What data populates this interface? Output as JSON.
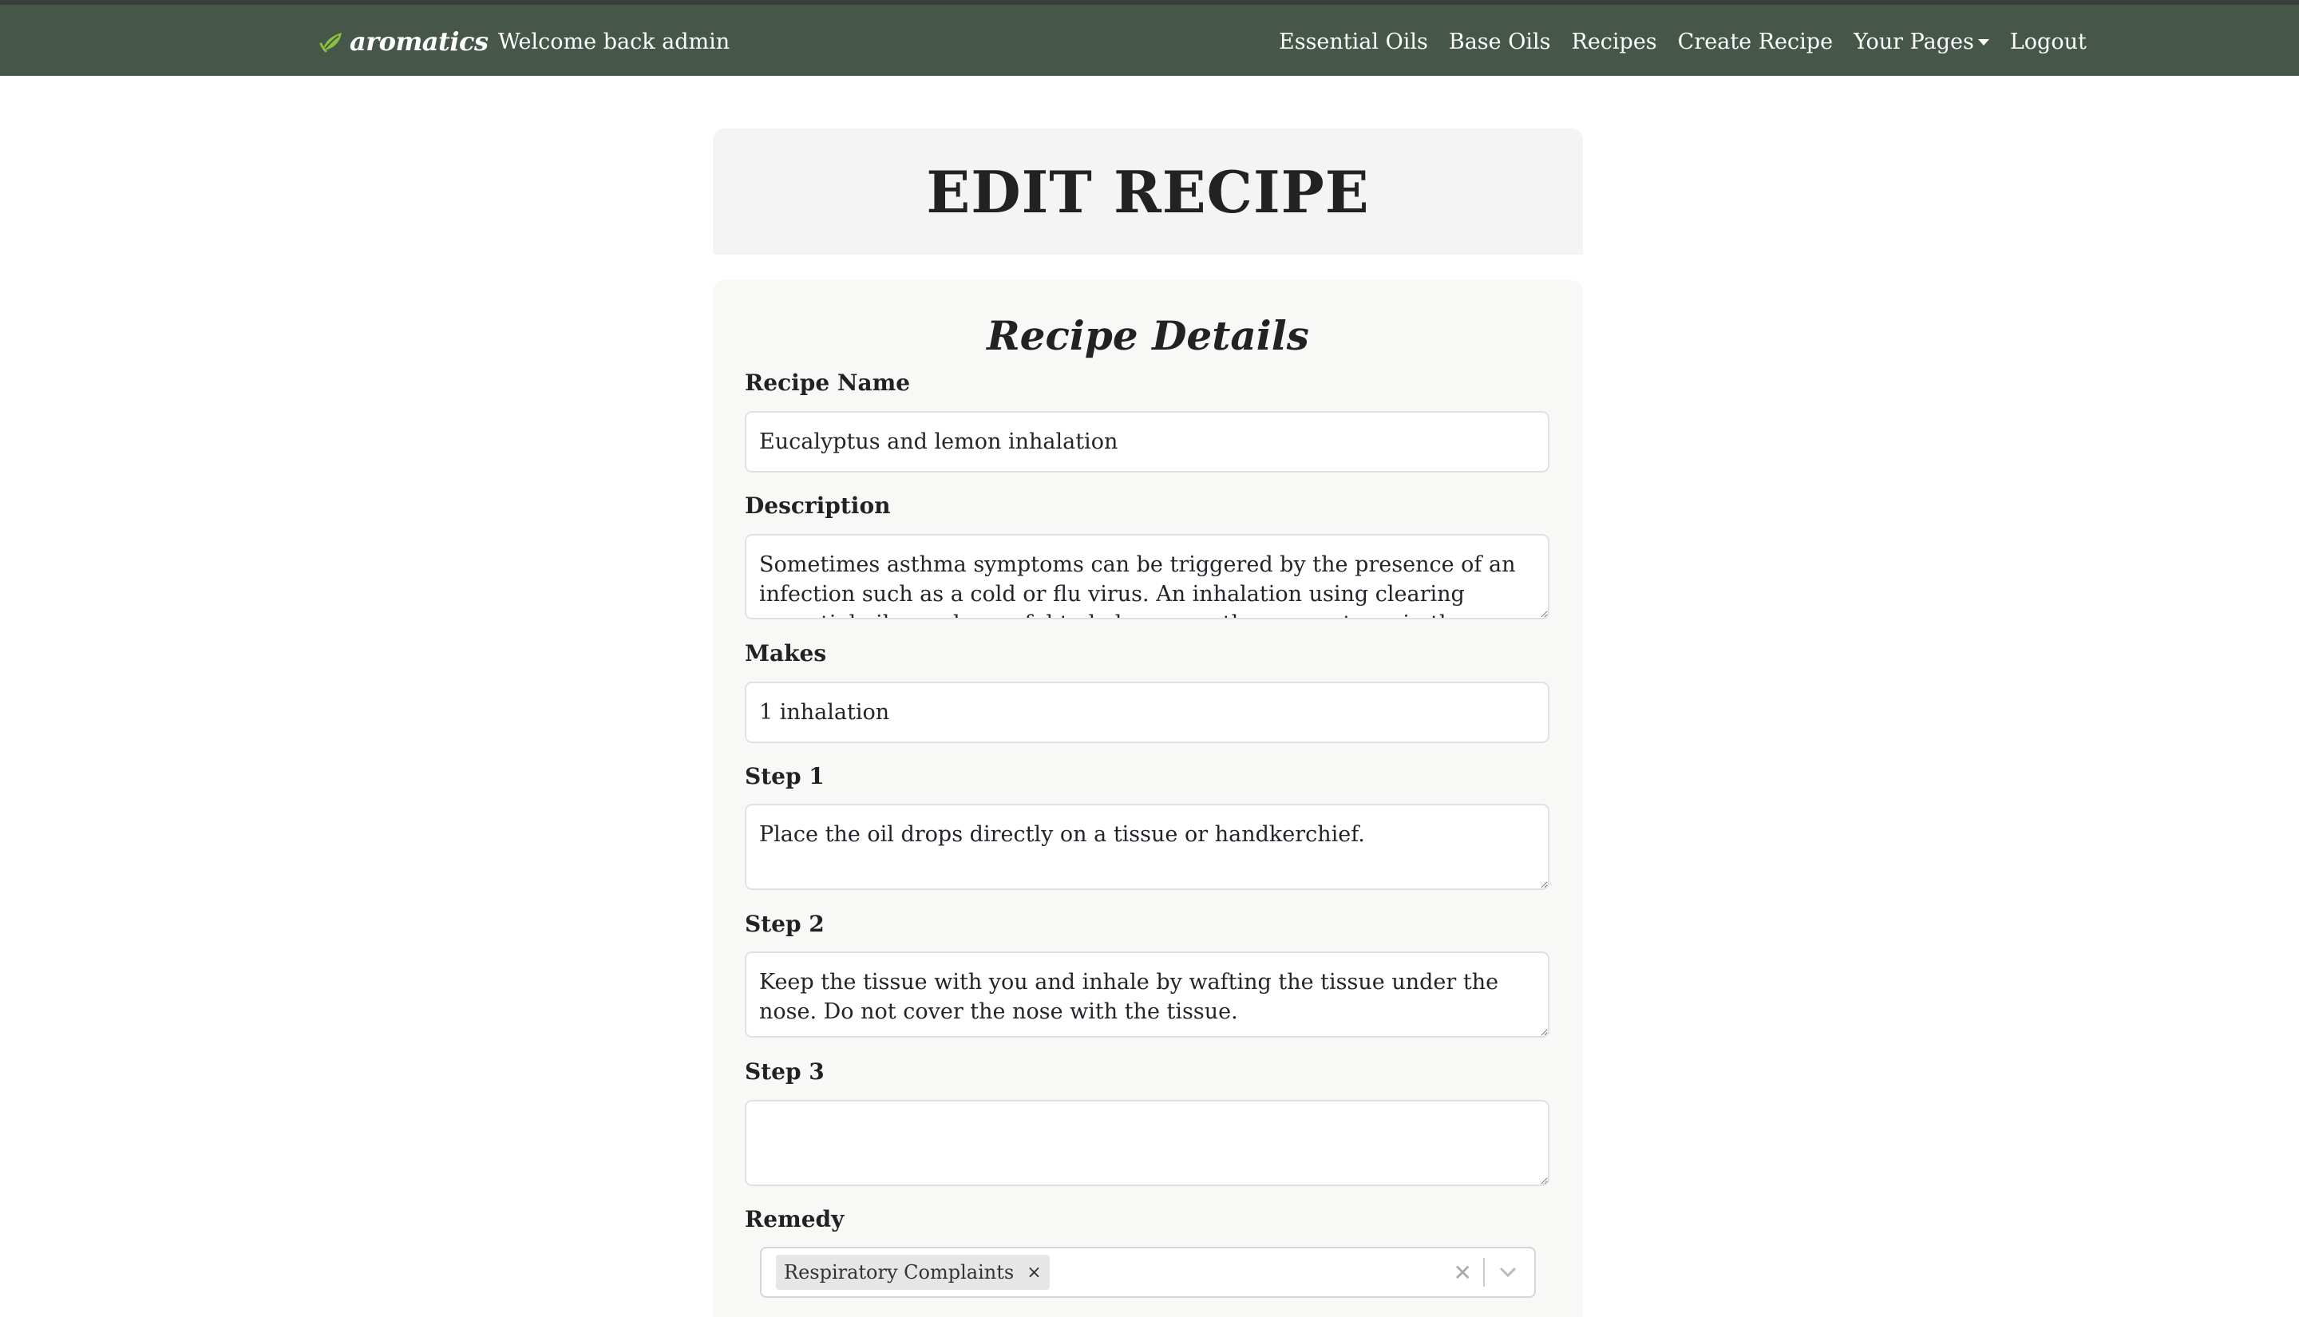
{
  "navbar": {
    "brand": "aromatics",
    "welcome": "Welcome back admin",
    "links": [
      {
        "label": "Essential Oils"
      },
      {
        "label": "Base Oils"
      },
      {
        "label": "Recipes"
      },
      {
        "label": "Create Recipe"
      },
      {
        "label": "Your Pages",
        "dropdown": true
      },
      {
        "label": "Logout"
      }
    ],
    "bg_color": "#46574a"
  },
  "page": {
    "title": "EDIT RECIPE"
  },
  "form": {
    "heading": "Recipe Details",
    "recipe_name": {
      "label": "Recipe Name",
      "value": "Eucalyptus and lemon inhalation"
    },
    "description": {
      "label": "Description",
      "value": "Sometimes asthma symptoms can be triggered by the presence of an infection such as a cold or flu virus. An inhalation using clearing essential oils can be useful to help ease asthma symptoms in these circumstances."
    },
    "makes": {
      "label": "Makes",
      "value": "1 inhalation"
    },
    "step1": {
      "label": "Step 1",
      "value": "Place the oil drops directly on a tissue or handkerchief."
    },
    "step2": {
      "label": "Step 2",
      "value": "Keep the tissue with you and inhale by wafting the tissue under the nose. Do not cover the nose with the tissue."
    },
    "step3": {
      "label": "Step 3",
      "value": ""
    },
    "remedy": {
      "label": "Remedy",
      "selected": [
        "Respiratory Complaints"
      ]
    }
  }
}
